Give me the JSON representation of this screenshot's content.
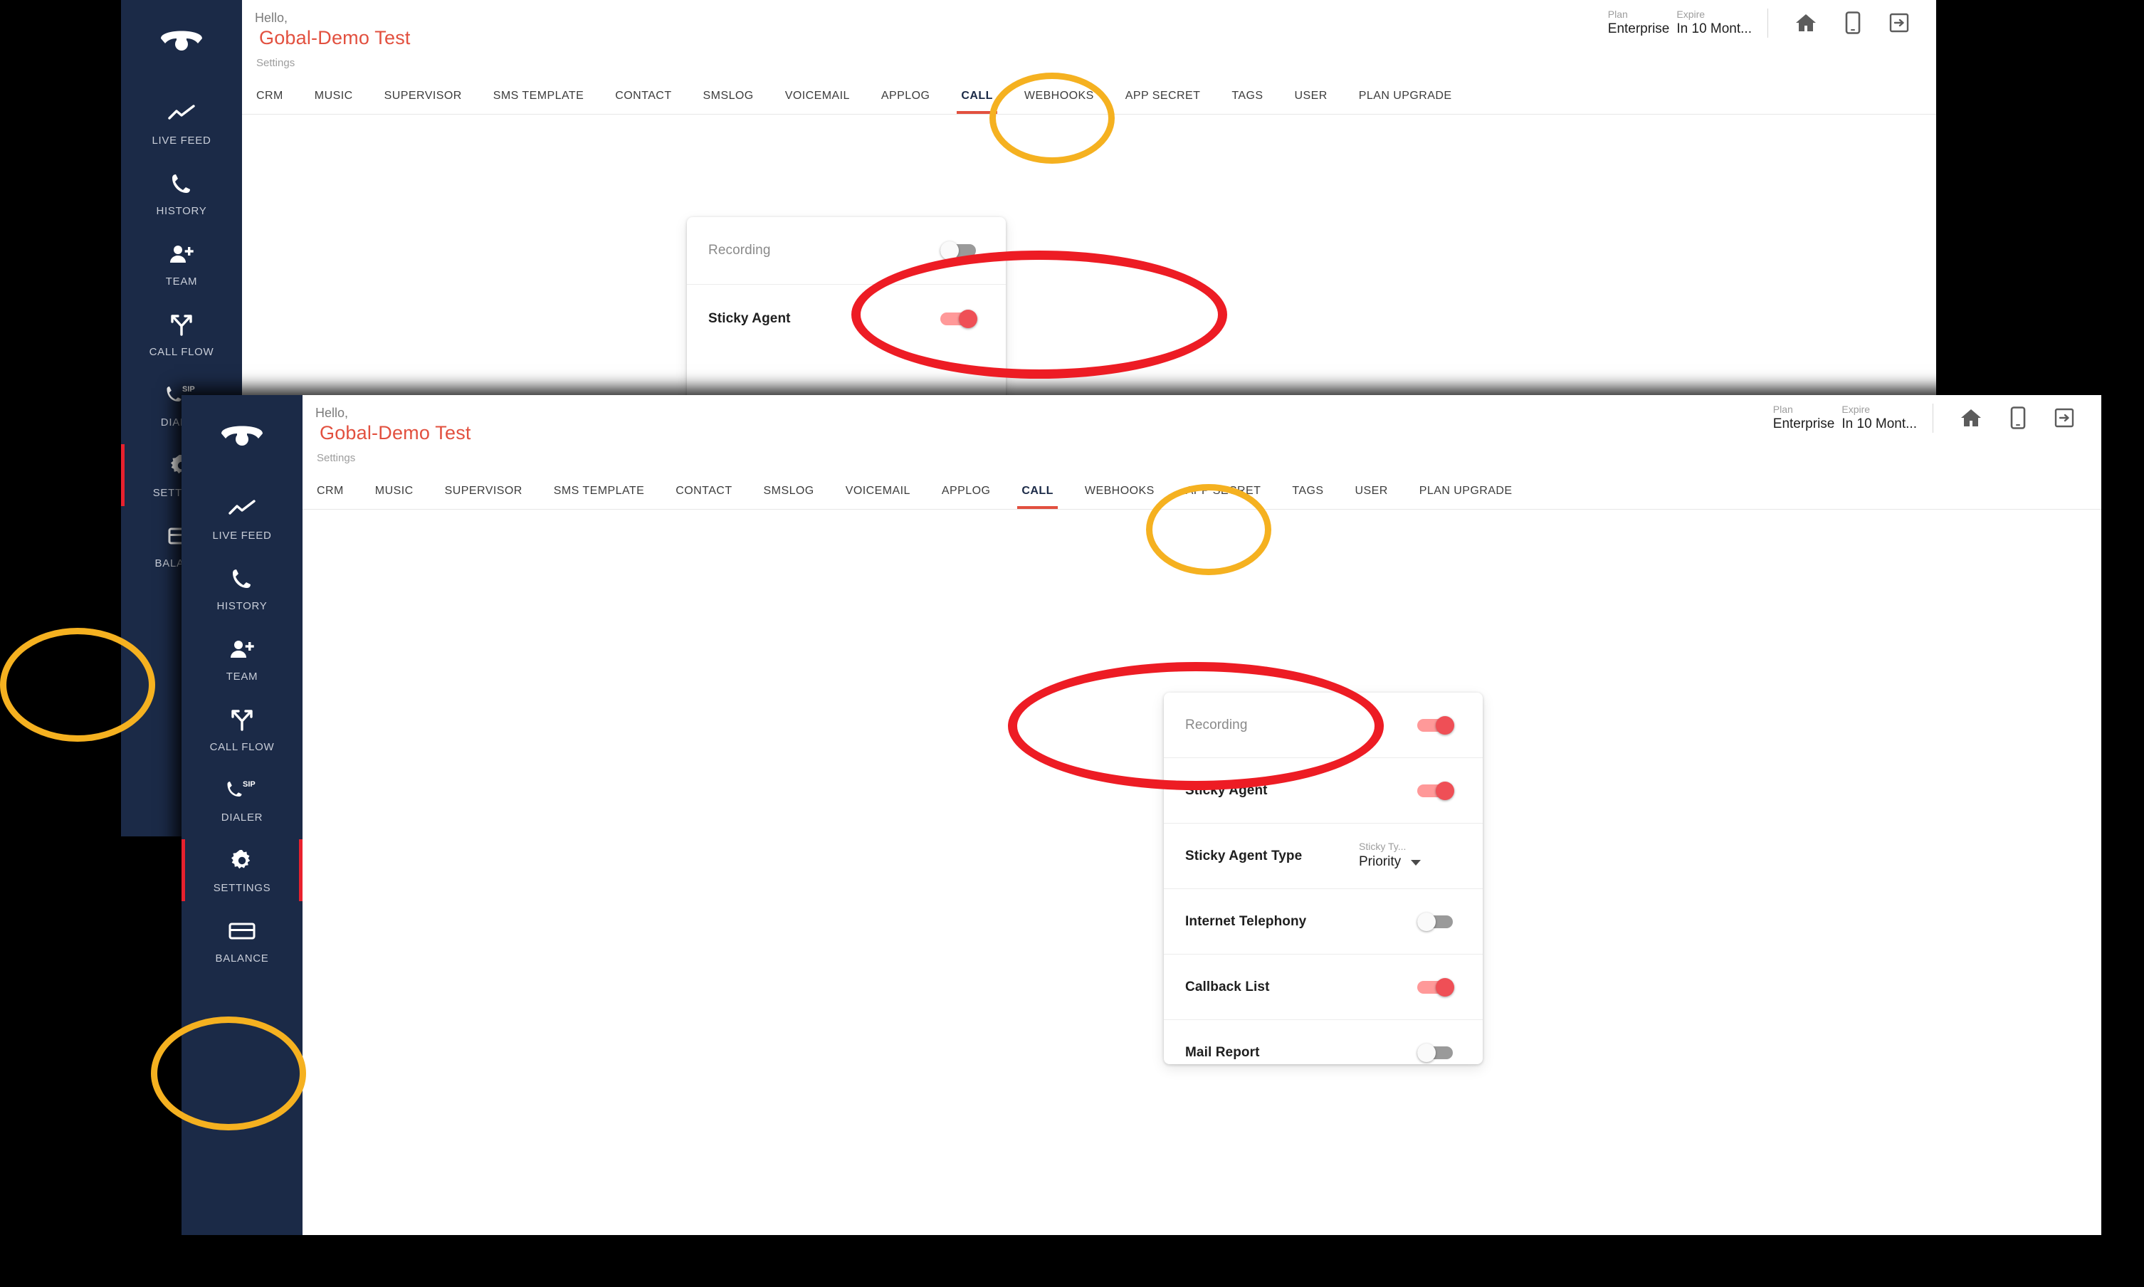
{
  "app": {
    "greeting": "Hello,",
    "account_name": "Gobal-Demo Test",
    "breadcrumb": "Settings",
    "plan": {
      "plan_caption": "Plan",
      "plan_value": "Enterprise",
      "expire_caption": "Expire",
      "expire_value": "In 10 Mont..."
    },
    "header_icons": [
      "home-icon",
      "mobile-icon",
      "logout-icon"
    ]
  },
  "colors": {
    "sidebar_bg": "#1b2a47",
    "brand_red": "#e2503f",
    "toggle_on": "#ef4f56",
    "toggle_off": "#9a9a9a",
    "active_marker": "#e8212e",
    "annot_orange": "#f5b120",
    "annot_red": "#ed1c24",
    "page_bg": "#000000"
  },
  "sidebar": {
    "logo_icon": "phone-handset-icon",
    "items": [
      {
        "label": "LIVE FEED",
        "icon": "trending-line-icon",
        "active": false
      },
      {
        "label": "HISTORY",
        "icon": "phone-icon",
        "active": false
      },
      {
        "label": "TEAM",
        "icon": "add-person-icon",
        "active": false
      },
      {
        "label": "CALL FLOW",
        "icon": "branch-arrows-icon",
        "active": false
      },
      {
        "label": "DIALER",
        "icon": "sip-phone-icon",
        "active": false
      },
      {
        "label": "SETTINGS",
        "icon": "gear-icon",
        "active": true
      },
      {
        "label": "BALANCE",
        "icon": "card-icon",
        "active": false
      }
    ]
  },
  "tabs": {
    "items": [
      "CRM",
      "MUSIC",
      "SUPERVISOR",
      "SMS TEMPLATE",
      "CONTACT",
      "SMSLOG",
      "VOICEMAIL",
      "APPLOG",
      "CALL",
      "WEBHOOKS",
      "APP SECRET",
      "TAGS",
      "USER",
      "PLAN UPGRADE"
    ],
    "selected": "CALL"
  },
  "back_window": {
    "settings_rows": [
      {
        "label": "Recording",
        "control": "toggle",
        "state": "off",
        "muted": true
      },
      {
        "label": "Sticky Agent",
        "control": "toggle",
        "state": "on",
        "muted": false
      }
    ]
  },
  "front_window": {
    "settings_rows": [
      {
        "label": "Recording",
        "control": "toggle",
        "state": "off_to_on",
        "toggle_state": "on",
        "muted": true
      },
      {
        "label": "Sticky Agent",
        "control": "toggle",
        "toggle_state": "on",
        "muted": false
      },
      {
        "label": "Sticky Agent Type",
        "control": "select",
        "select_caption": "Sticky Ty...",
        "select_value": "Priority",
        "muted": false
      },
      {
        "label": "Internet Telephony",
        "control": "toggle",
        "toggle_state": "off",
        "muted": false
      },
      {
        "label": "Callback List",
        "control": "toggle",
        "toggle_state": "on",
        "muted": false
      },
      {
        "label": "Mail Report",
        "control": "toggle",
        "toggle_state": "off",
        "muted": false
      }
    ]
  },
  "annotations": [
    {
      "name": "highlight-call-tab-back",
      "shape": "ellipse",
      "color": "#f5b120"
    },
    {
      "name": "highlight-recording-row-back",
      "shape": "ellipse",
      "color": "#ed1c24"
    },
    {
      "name": "highlight-settings-nav-back",
      "shape": "ellipse",
      "color": "#f5b120"
    },
    {
      "name": "highlight-call-tab-front",
      "shape": "ellipse",
      "color": "#f5b120"
    },
    {
      "name": "highlight-recording-row-front",
      "shape": "ellipse",
      "color": "#ed1c24"
    },
    {
      "name": "highlight-settings-nav-front",
      "shape": "ellipse",
      "color": "#f5b120"
    }
  ]
}
